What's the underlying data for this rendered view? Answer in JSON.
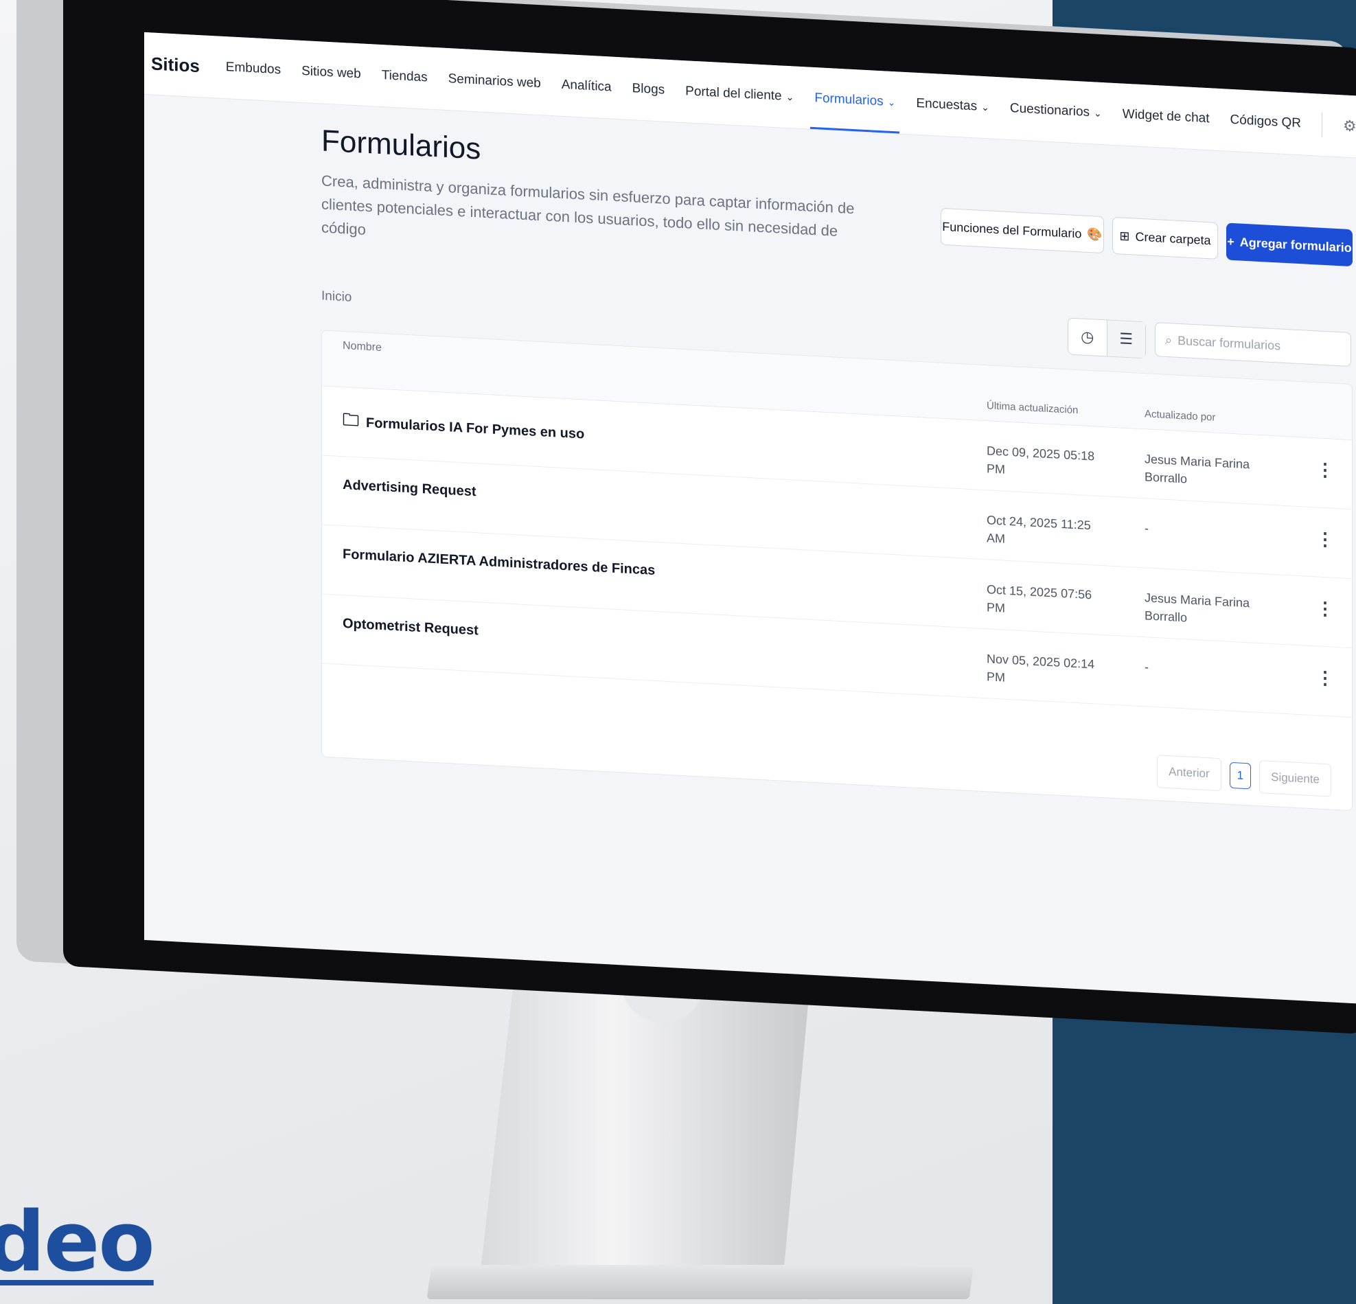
{
  "brand_watermark": "deo",
  "nav": {
    "brand": "Sitios",
    "items": [
      {
        "label": "Embudos",
        "dropdown": false,
        "active": false
      },
      {
        "label": "Sitios web",
        "dropdown": false,
        "active": false
      },
      {
        "label": "Tiendas",
        "dropdown": false,
        "active": false
      },
      {
        "label": "Seminarios web",
        "dropdown": false,
        "active": false
      },
      {
        "label": "Analítica",
        "dropdown": false,
        "active": false
      },
      {
        "label": "Blogs",
        "dropdown": false,
        "active": false
      },
      {
        "label": "Portal del cliente",
        "dropdown": true,
        "active": false
      },
      {
        "label": "Formularios",
        "dropdown": true,
        "active": true
      },
      {
        "label": "Encuestas",
        "dropdown": true,
        "active": false
      },
      {
        "label": "Cuestionarios",
        "dropdown": true,
        "active": false
      },
      {
        "label": "Widget de chat",
        "dropdown": false,
        "active": false
      },
      {
        "label": "Códigos QR",
        "dropdown": false,
        "active": false
      }
    ],
    "settings_icon": "gear-icon"
  },
  "header": {
    "title": "Formularios",
    "description": "Crea, administra y organiza formularios sin esfuerzo para captar información de clientes potenciales e interactuar con los usuarios, todo ello sin necesidad de código"
  },
  "actions": {
    "features_label": "Funciones del Formulario",
    "features_emoji": "🎨",
    "create_folder_label": "Crear carpeta",
    "add_form_label": "Agregar formulario"
  },
  "breadcrumb": "Inicio",
  "search": {
    "placeholder": "Buscar formularios"
  },
  "table": {
    "columns": {
      "name": "Nombre",
      "updated": "Última actualización",
      "updated_by": "Actualizado por"
    },
    "rows": [
      {
        "name": "Formularios IA For Pymes en uso",
        "is_folder": true,
        "date_line1": "Dec 09, 2025 05:18",
        "date_line2": "PM",
        "by_line1": "Jesus Maria Farina",
        "by_line2": "Borrallo"
      },
      {
        "name": "Advertising Request",
        "is_folder": false,
        "date_line1": "Oct 24, 2025 11:25",
        "date_line2": "AM",
        "by_line1": "-",
        "by_line2": ""
      },
      {
        "name": "Formulario  AZIERTA  Administradores  de Fincas",
        "is_folder": false,
        "date_line1": "Oct 15, 2025 07:56",
        "date_line2": "PM",
        "by_line1": "Jesus Maria Farina",
        "by_line2": "Borrallo"
      },
      {
        "name": "Optometrist Request",
        "is_folder": false,
        "date_line1": "Nov 05, 2025 02:14",
        "date_line2": "PM",
        "by_line1": "-",
        "by_line2": ""
      }
    ]
  },
  "pagination": {
    "prev": "Anterior",
    "page": "1",
    "next": "Siguiente"
  },
  "colors": {
    "accent": "#1d4ed8",
    "panel": "#1a4567"
  }
}
